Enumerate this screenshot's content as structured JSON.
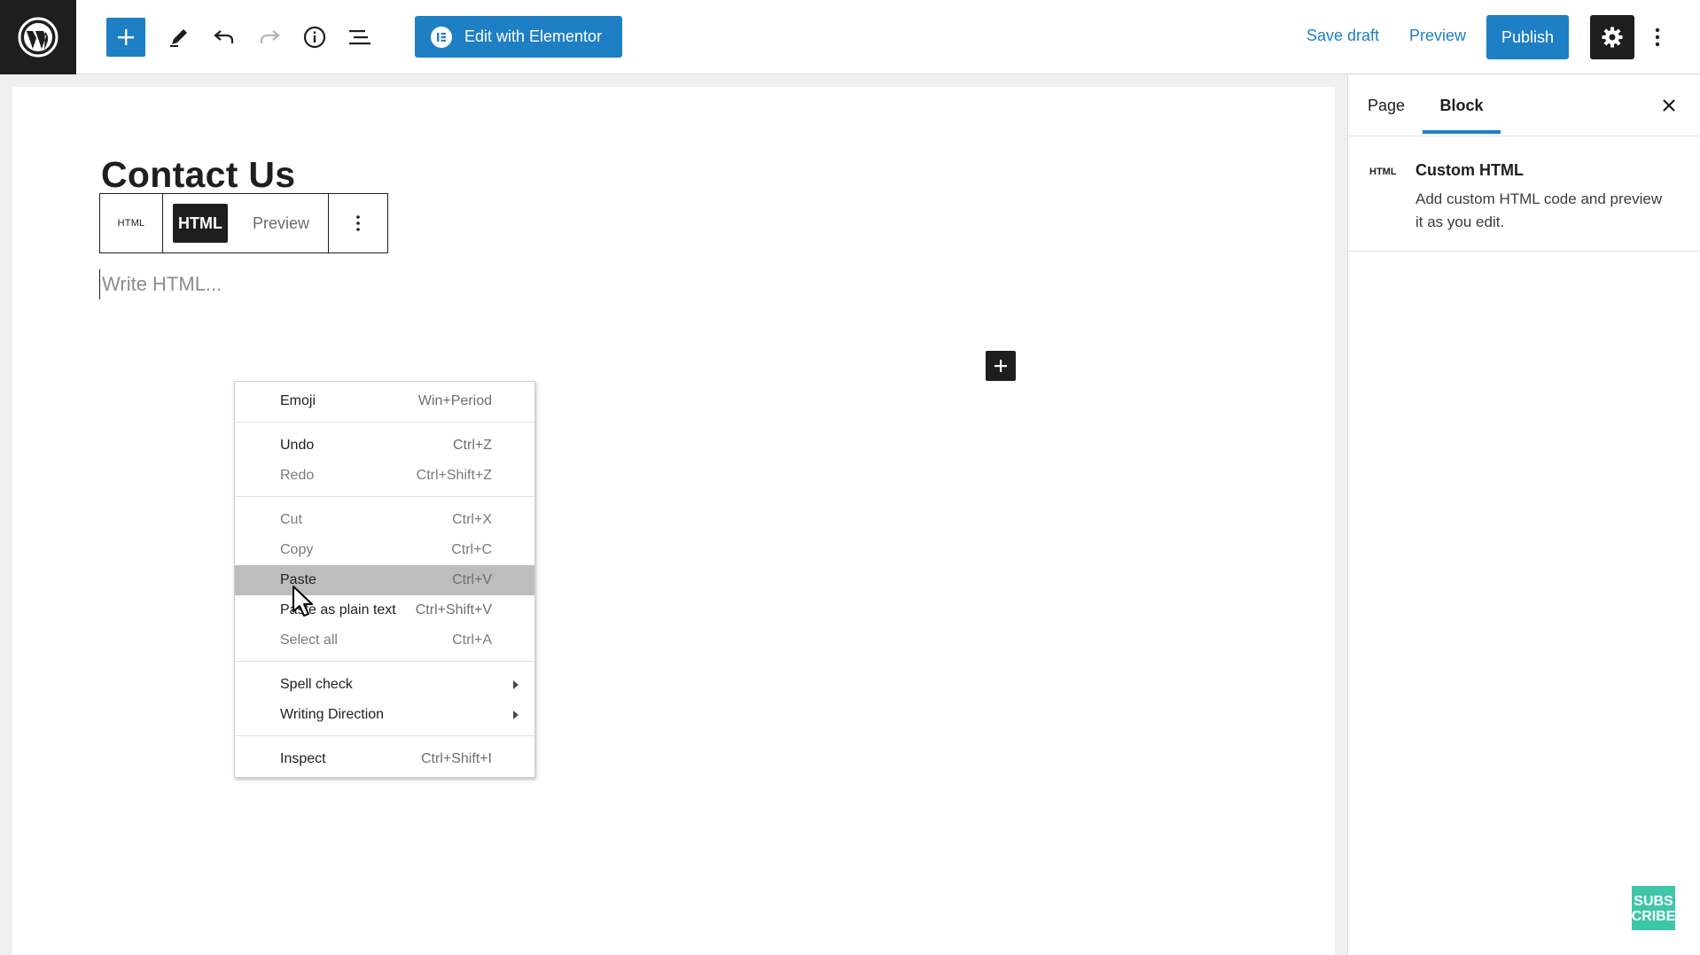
{
  "toolbar": {
    "elementor_label": "Edit with Elementor",
    "save_draft": "Save draft",
    "preview": "Preview",
    "publish": "Publish",
    "accent_color": "#1e7fc4"
  },
  "editor": {
    "page_title": "Contact Us",
    "block_toolbar": {
      "type_label": "HTML",
      "html_tab": "HTML",
      "preview_tab": "Preview"
    },
    "html_placeholder": "Write HTML..."
  },
  "context_menu": {
    "items": [
      {
        "label": "Emoji",
        "shortcut": "Win+Period",
        "disabled": false
      },
      {
        "label": "Undo",
        "shortcut": "Ctrl+Z",
        "disabled": false
      },
      {
        "label": "Redo",
        "shortcut": "Ctrl+Shift+Z",
        "disabled": true
      },
      {
        "label": "Cut",
        "shortcut": "Ctrl+X",
        "disabled": true
      },
      {
        "label": "Copy",
        "shortcut": "Ctrl+C",
        "disabled": true
      },
      {
        "label": "Paste",
        "shortcut": "Ctrl+V",
        "disabled": false,
        "hovered": true
      },
      {
        "label": "Paste as plain text",
        "shortcut": "Ctrl+Shift+V",
        "disabled": false
      },
      {
        "label": "Select all",
        "shortcut": "Ctrl+A",
        "disabled": true
      },
      {
        "label": "Spell check",
        "shortcut": "",
        "submenu": true
      },
      {
        "label": "Writing Direction",
        "shortcut": "",
        "submenu": true
      },
      {
        "label": "Inspect",
        "shortcut": "Ctrl+Shift+I",
        "disabled": false
      }
    ]
  },
  "sidebar": {
    "tabs": [
      "Page",
      "Block"
    ],
    "active_tab": "Block",
    "block_card": {
      "icon_label": "HTML",
      "title": "Custom HTML",
      "description": "Add custom HTML code and preview it as you edit."
    }
  },
  "watermark": {
    "line1": "SUBS",
    "line2": "CRIBE",
    "color": "#3ec6a8"
  }
}
